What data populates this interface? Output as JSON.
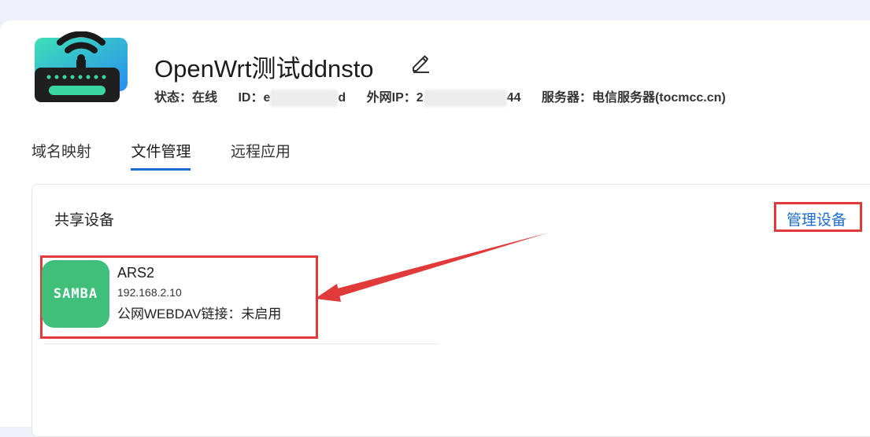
{
  "device": {
    "title": "OpenWrt测试ddnsto",
    "status_label": "状态：",
    "status_value": "在线",
    "id_label": "ID：",
    "id_start": "e",
    "id_end": "d",
    "ip_label": "外网IP：",
    "ip_start": "2",
    "ip_end": "44",
    "server_label": "服务器：",
    "server_value": "电信服务器(tocmcc.cn)"
  },
  "tabs": [
    {
      "label": "域名映射",
      "active": false
    },
    {
      "label": "文件管理",
      "active": true
    },
    {
      "label": "远程应用",
      "active": false
    }
  ],
  "panel": {
    "title": "共享设备",
    "manage_label": "管理设备"
  },
  "devices": [
    {
      "icon_text": "SAMBA",
      "name": "ARS2",
      "ip": "192.168.2.10",
      "webdav_label": "公网WEBDAV链接：",
      "webdav_value": "未启用"
    }
  ],
  "colors": {
    "accent": "#1c6dd0",
    "highlight": "#e03a3a",
    "samba_green": "#3fbf7a"
  }
}
